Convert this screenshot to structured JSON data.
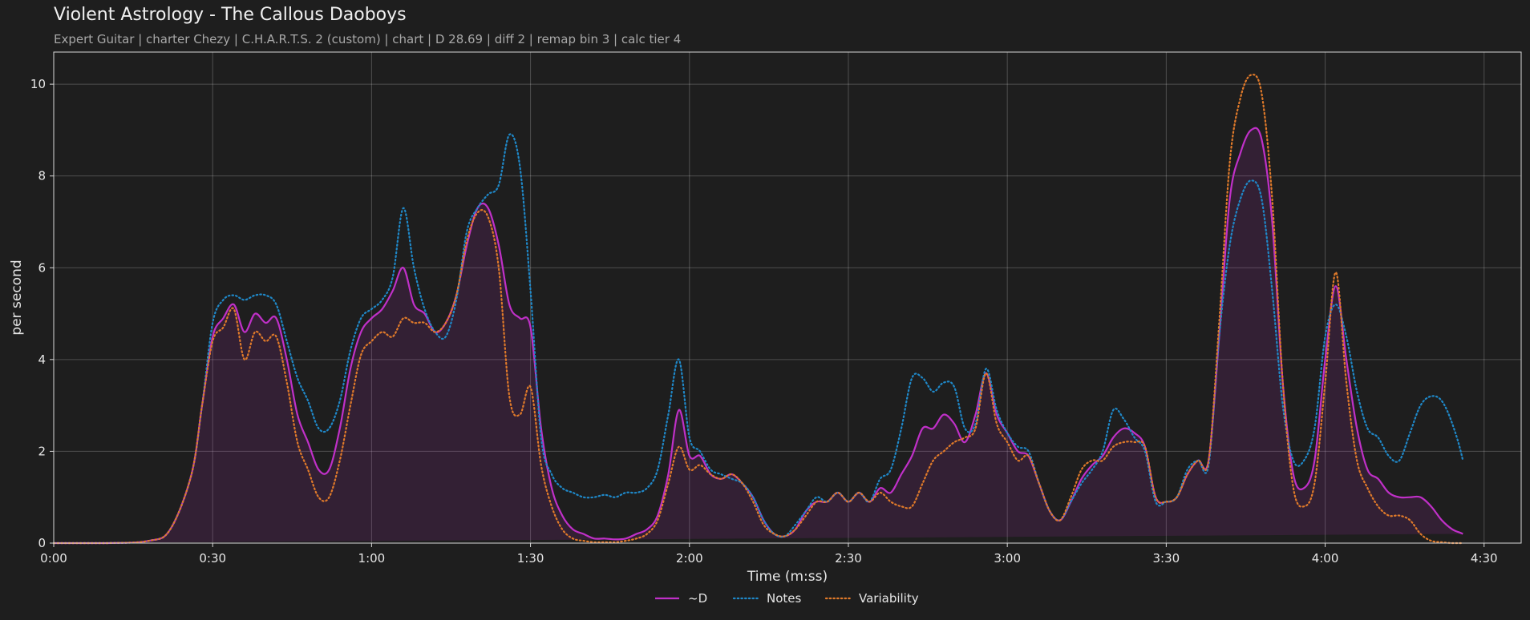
{
  "chart_data": {
    "type": "line",
    "title": "Violent Astrology - The Callous Daoboys",
    "subtitle": "Expert Guitar  |  charter Chezy  |  C.H.A.R.T.S. 2 (custom)  |  chart  |  D 28.69  |  diff 2  |  remap bin 3  |  calc tier 4",
    "xlabel": "Time (m:ss)",
    "ylabel": "per second",
    "xlim": [
      0,
      277
    ],
    "ylim": [
      0,
      10.7
    ],
    "grid": true,
    "legend_position": "bottom-center",
    "x_tick_values": [
      0,
      30,
      60,
      90,
      120,
      150,
      180,
      210,
      240,
      270
    ],
    "x_tick_labels": [
      "0:00",
      "0:30",
      "1:00",
      "1:30",
      "2:00",
      "2:30",
      "3:00",
      "3:30",
      "4:00",
      "4:30"
    ],
    "y_ticks": [
      0,
      2,
      4,
      6,
      8,
      10
    ],
    "x": [
      0,
      10,
      18,
      22,
      26,
      28,
      30,
      32,
      34,
      36,
      38,
      40,
      42,
      44,
      46,
      48,
      50,
      52,
      54,
      56,
      58,
      60,
      62,
      64,
      66,
      68,
      70,
      72,
      74,
      76,
      78,
      80,
      82,
      84,
      86,
      88,
      90,
      92,
      94,
      96,
      98,
      100,
      102,
      104,
      106,
      108,
      110,
      112,
      114,
      116,
      118,
      120,
      122,
      124,
      126,
      128,
      130,
      132,
      134,
      136,
      138,
      140,
      142,
      144,
      146,
      148,
      150,
      152,
      154,
      156,
      158,
      160,
      162,
      164,
      166,
      168,
      170,
      172,
      174,
      176,
      178,
      180,
      182,
      184,
      186,
      188,
      190,
      192,
      194,
      196,
      198,
      200,
      202,
      204,
      206,
      208,
      210,
      212,
      214,
      216,
      218,
      220,
      222,
      224,
      226,
      228,
      230,
      232,
      234,
      236,
      238,
      240,
      242,
      244,
      246,
      248,
      250,
      252,
      254,
      256,
      258,
      260,
      262,
      264,
      266,
      268,
      270,
      272,
      274,
      277
    ],
    "series": [
      {
        "name": "~D",
        "color": "#c030c8",
        "style": "solid",
        "fill": true,
        "values": [
          0,
          0,
          0.05,
          0.3,
          1.5,
          3.0,
          4.5,
          4.9,
          5.2,
          4.6,
          5.0,
          4.8,
          4.9,
          4.0,
          2.8,
          2.2,
          1.6,
          1.6,
          2.5,
          3.8,
          4.6,
          4.9,
          5.1,
          5.5,
          6.0,
          5.2,
          5.0,
          4.6,
          4.8,
          5.4,
          6.5,
          7.3,
          7.3,
          6.5,
          5.2,
          4.9,
          4.7,
          2.5,
          1.2,
          0.6,
          0.3,
          0.2,
          0.1,
          0.1,
          0.08,
          0.1,
          0.2,
          0.3,
          0.6,
          1.5,
          2.9,
          1.9,
          1.9,
          1.5,
          1.4,
          1.5,
          1.3,
          1.0,
          0.5,
          0.2,
          0.15,
          0.3,
          0.7,
          0.9,
          0.9,
          1.1,
          0.9,
          1.1,
          0.9,
          1.2,
          1.1,
          1.5,
          1.9,
          2.5,
          2.5,
          2.8,
          2.6,
          2.2,
          2.8,
          3.7,
          2.8,
          2.4,
          2.0,
          1.9,
          1.3,
          0.7,
          0.5,
          0.9,
          1.4,
          1.7,
          1.9,
          2.3,
          2.5,
          2.4,
          2.1,
          1.0,
          0.9,
          1.0,
          1.5,
          1.8,
          1.8,
          4.5,
          7.5,
          8.5,
          9.0,
          8.8,
          7.0,
          3.5,
          1.5,
          1.2,
          1.8,
          4.0,
          5.6,
          4.0,
          2.5,
          1.6,
          1.4,
          1.1,
          1.0,
          1.0,
          1.0,
          0.8,
          0.5,
          0.3,
          0.2,
          0.05
        ]
      },
      {
        "name": "Notes",
        "color": "#1f88c8",
        "style": "dotted",
        "fill": false,
        "values": [
          0,
          0,
          0.05,
          0.3,
          1.5,
          3.0,
          4.8,
          5.3,
          5.4,
          5.3,
          5.4,
          5.4,
          5.2,
          4.4,
          3.6,
          3.1,
          2.5,
          2.5,
          3.1,
          4.2,
          4.9,
          5.1,
          5.3,
          5.8,
          7.3,
          6.0,
          5.1,
          4.6,
          4.5,
          5.3,
          6.8,
          7.3,
          7.6,
          7.8,
          8.9,
          8.2,
          5.5,
          2.3,
          1.5,
          1.2,
          1.1,
          1.0,
          1.0,
          1.05,
          1.0,
          1.1,
          1.1,
          1.2,
          1.6,
          2.8,
          4.0,
          2.3,
          2.0,
          1.6,
          1.5,
          1.4,
          1.3,
          1.0,
          0.5,
          0.2,
          0.15,
          0.4,
          0.7,
          1.0,
          0.9,
          1.1,
          0.9,
          1.1,
          0.9,
          1.4,
          1.6,
          2.5,
          3.6,
          3.6,
          3.3,
          3.5,
          3.4,
          2.5,
          2.6,
          3.8,
          2.9,
          2.4,
          2.1,
          2.0,
          1.3,
          0.7,
          0.5,
          0.9,
          1.3,
          1.6,
          2.0,
          2.9,
          2.7,
          2.3,
          2.0,
          0.9,
          0.9,
          1.0,
          1.6,
          1.8,
          1.7,
          4.5,
          6.5,
          7.5,
          7.9,
          7.5,
          5.5,
          3.0,
          1.8,
          1.8,
          2.5,
          4.5,
          5.2,
          4.5,
          3.3,
          2.5,
          2.3,
          1.9,
          1.8,
          2.4,
          3.0,
          3.2,
          3.1,
          2.6,
          1.8,
          0.5
        ]
      },
      {
        "name": "Variability",
        "color": "#e07a2a",
        "style": "dotted",
        "fill": false,
        "values": [
          0,
          0,
          0.05,
          0.3,
          1.5,
          3.0,
          4.4,
          4.7,
          5.1,
          4.0,
          4.6,
          4.4,
          4.5,
          3.5,
          2.2,
          1.6,
          1.0,
          1.0,
          1.8,
          3.0,
          4.1,
          4.4,
          4.6,
          4.5,
          4.9,
          4.8,
          4.8,
          4.6,
          4.8,
          5.4,
          6.6,
          7.2,
          7.1,
          6.0,
          3.2,
          2.8,
          3.4,
          1.7,
          0.8,
          0.3,
          0.1,
          0.05,
          0.02,
          0.02,
          0.02,
          0.05,
          0.1,
          0.2,
          0.5,
          1.3,
          2.1,
          1.6,
          1.7,
          1.5,
          1.4,
          1.5,
          1.3,
          0.9,
          0.4,
          0.2,
          0.15,
          0.3,
          0.6,
          0.9,
          0.9,
          1.1,
          0.9,
          1.1,
          0.9,
          1.1,
          0.9,
          0.8,
          0.8,
          1.3,
          1.8,
          2.0,
          2.2,
          2.3,
          2.5,
          3.7,
          2.6,
          2.2,
          1.8,
          1.9,
          1.3,
          0.7,
          0.5,
          1.0,
          1.6,
          1.8,
          1.8,
          2.1,
          2.2,
          2.2,
          2.1,
          1.0,
          0.9,
          1.0,
          1.5,
          1.8,
          1.8,
          4.8,
          8.3,
          9.7,
          10.2,
          9.8,
          7.5,
          3.5,
          1.2,
          0.8,
          1.3,
          3.5,
          5.9,
          3.5,
          1.8,
          1.2,
          0.8,
          0.6,
          0.6,
          0.5,
          0.2,
          0.05,
          0.02,
          0,
          0,
          0
        ]
      }
    ]
  }
}
